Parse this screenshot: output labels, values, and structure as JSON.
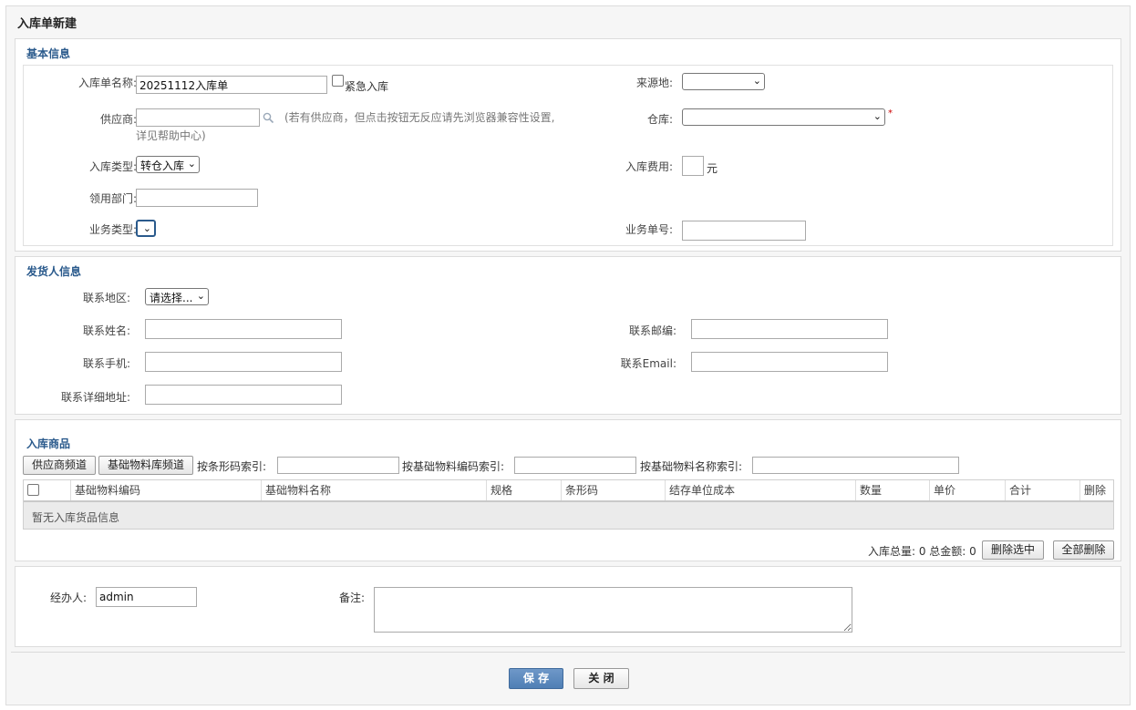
{
  "page_title": "入库单新建",
  "basic": {
    "title": "基本信息",
    "name_label": "入库单名称:",
    "name_value": "20251112入库单",
    "urgent_label": "紧急入库",
    "origin_label": "来源地:",
    "supplier_label": "供应商:",
    "supplier_hint_1": "(若有供应商，但点击按钮无反应请先浏览器兼容性设置,",
    "supplier_hint_2": "详见帮助中心)",
    "warehouse_label": "仓库:",
    "required_mark": "*",
    "type_label": "入库类型:",
    "type_value": "转仓入库",
    "fee_label": "入库费用:",
    "fee_unit": "元",
    "dept_label": "领用部门:",
    "biz_type_label": "业务类型:",
    "biz_no_label": "业务单号:"
  },
  "sender": {
    "title": "发货人信息",
    "region_label": "联系地区:",
    "region_value": "请选择...",
    "name_label": "联系姓名:",
    "zip_label": "联系邮编:",
    "mobile_label": "联系手机:",
    "email_label": "联系Email:",
    "address_label": "联系详细地址:"
  },
  "goods": {
    "title": "入库商品",
    "supplier_channel_btn": "供应商频道",
    "material_channel_btn": "基础物料库频道",
    "barcode_index_label": "按条形码索引:",
    "code_index_label": "按基础物料编码索引:",
    "name_index_label": "按基础物料名称索引:",
    "columns": [
      "基础物料编码",
      "基础物料名称",
      "规格",
      "条形码",
      "结存单位成本",
      "数量",
      "单价",
      "合计",
      "删除"
    ],
    "empty_text": "暂无入库货品信息",
    "total_text": "入库总量: 0 总金额: 0",
    "delete_selected_btn": "删除选中",
    "delete_all_btn": "全部删除"
  },
  "footer": {
    "handler_label": "经办人:",
    "handler_value": "admin",
    "remark_label": "备注:",
    "save_btn": "保 存",
    "close_btn": "关 闭"
  },
  "colors": {
    "section_title": "#2a5a8c",
    "primary_button": "#4f7fb5",
    "required": "#cc0000"
  }
}
